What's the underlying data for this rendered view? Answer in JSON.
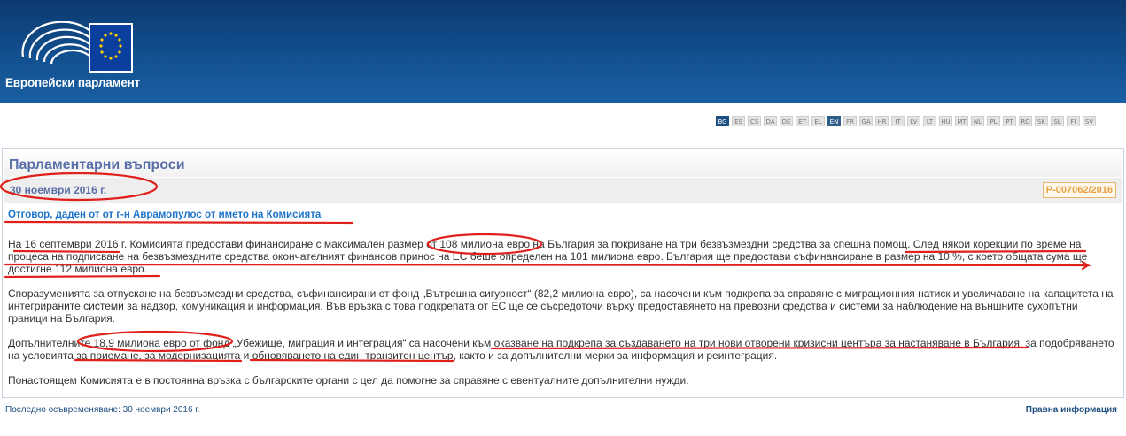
{
  "header": {
    "brand": "Европейски парламент",
    "colors": {
      "band": "#12508f",
      "eu_flag": "#0a3f9e",
      "stars": "#ffcc00"
    }
  },
  "languages": [
    "BG",
    "ES",
    "CS",
    "DA",
    "DE",
    "ET",
    "EL",
    "EN",
    "FR",
    "GA",
    "HR",
    "IT",
    "LV",
    "LT",
    "HU",
    "MT",
    "NL",
    "PL",
    "PT",
    "RO",
    "SK",
    "SL",
    "FI",
    "SV"
  ],
  "current_language": "BG",
  "highlighted_language": "EN",
  "content": {
    "page_title": "Парламентарни въпроси",
    "date": "30 ноември 2016 г.",
    "reference": "P-007062/2016",
    "answer_title": "Отговор, даден от от г-н Аврамопулос от името на Комисията",
    "paragraphs": [
      "На 16 септември 2016 г. Комисията предостави финансиране с максимален размер от 108 милиона евро на България за покриване на три безвъзмездни средства за спешна помощ. След някои корекции по време на процеса на подписване на безвъзмездните средства окончателният финансов принос на ЕС беше определен на 101 милиона евро. България ще предостави съфинансиране в размер на 10 %, с което общата сума ще достигне 112 милиона евро.",
      "Споразуменията за отпускане на безвъзмездни средства, съфинансирани от фонд „Вътрешна сигурност“ (82,2 милиона евро), са насочени към подкрепа за справяне с миграционния натиск и увеличаване на капацитета на интегрираните системи за надзор, комуникация и информация. Във връзка с това подкрепата от ЕС ще се съсредоточи върху предоставянето на превозни средства и системи за наблюдение на външните сухопътни граници на България.",
      "Допълнителните 18,9 милиона евро от фонд „Убежище, миграция и интеграция“ са насочени към оказване на подкрепа за създаването на три нови отворени кризисни центъра за настаняване в България, за подобряването на условията за приемане, за модернизацията и обновяването на един транзитен център, както и за допълнителни мерки за информация и реинтеграция.",
      "Понастоящем Комисията е в постоянна връзка с българските органи с цел да помогне за справяне с евентуалните допълнителни нужди."
    ]
  },
  "footer": {
    "last_updated": "Последно осъвременяване: 30 ноември 2016 г.",
    "legal": "Правна информация"
  },
  "annotation_color": "#e0201b"
}
